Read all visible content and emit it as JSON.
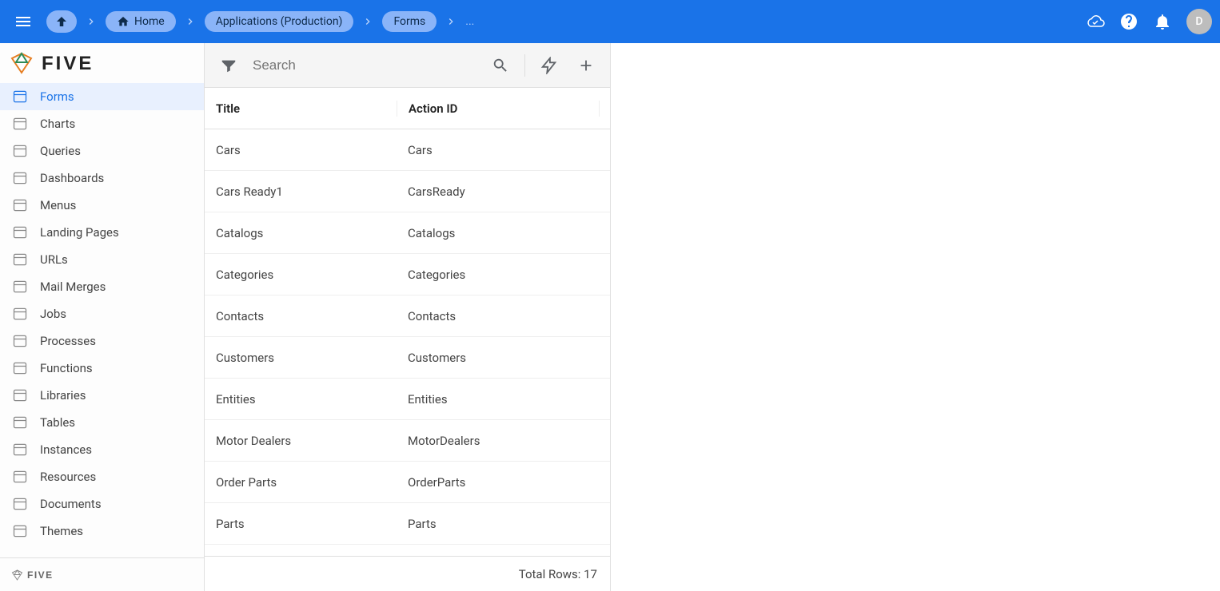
{
  "topbar": {
    "breadcrumbs": {
      "home": "Home",
      "app": "Applications (Production)",
      "section": "Forms",
      "trailing": "..."
    },
    "avatar_letter": "D"
  },
  "sidebar": {
    "items": [
      {
        "label": "Forms",
        "active": true
      },
      {
        "label": "Charts",
        "active": false
      },
      {
        "label": "Queries",
        "active": false
      },
      {
        "label": "Dashboards",
        "active": false
      },
      {
        "label": "Menus",
        "active": false
      },
      {
        "label": "Landing Pages",
        "active": false
      },
      {
        "label": "URLs",
        "active": false
      },
      {
        "label": "Mail Merges",
        "active": false
      },
      {
        "label": "Jobs",
        "active": false
      },
      {
        "label": "Processes",
        "active": false
      },
      {
        "label": "Functions",
        "active": false
      },
      {
        "label": "Libraries",
        "active": false
      },
      {
        "label": "Tables",
        "active": false
      },
      {
        "label": "Instances",
        "active": false
      },
      {
        "label": "Resources",
        "active": false
      },
      {
        "label": "Documents",
        "active": false
      },
      {
        "label": "Themes",
        "active": false
      }
    ]
  },
  "list": {
    "search_placeholder": "Search",
    "columns": {
      "title": "Title",
      "action_id": "Action ID"
    },
    "rows": [
      {
        "title": "Cars",
        "action_id": "Cars"
      },
      {
        "title": "Cars Ready1",
        "action_id": "CarsReady"
      },
      {
        "title": "Catalogs",
        "action_id": "Catalogs"
      },
      {
        "title": "Categories",
        "action_id": "Categories"
      },
      {
        "title": "Contacts",
        "action_id": "Contacts"
      },
      {
        "title": "Customers",
        "action_id": "Customers"
      },
      {
        "title": "Entities",
        "action_id": "Entities"
      },
      {
        "title": "Motor Dealers",
        "action_id": "MotorDealers"
      },
      {
        "title": "Order Parts",
        "action_id": "OrderParts"
      },
      {
        "title": "Parts",
        "action_id": "Parts"
      }
    ],
    "footer_label": "Total Rows: 17"
  }
}
